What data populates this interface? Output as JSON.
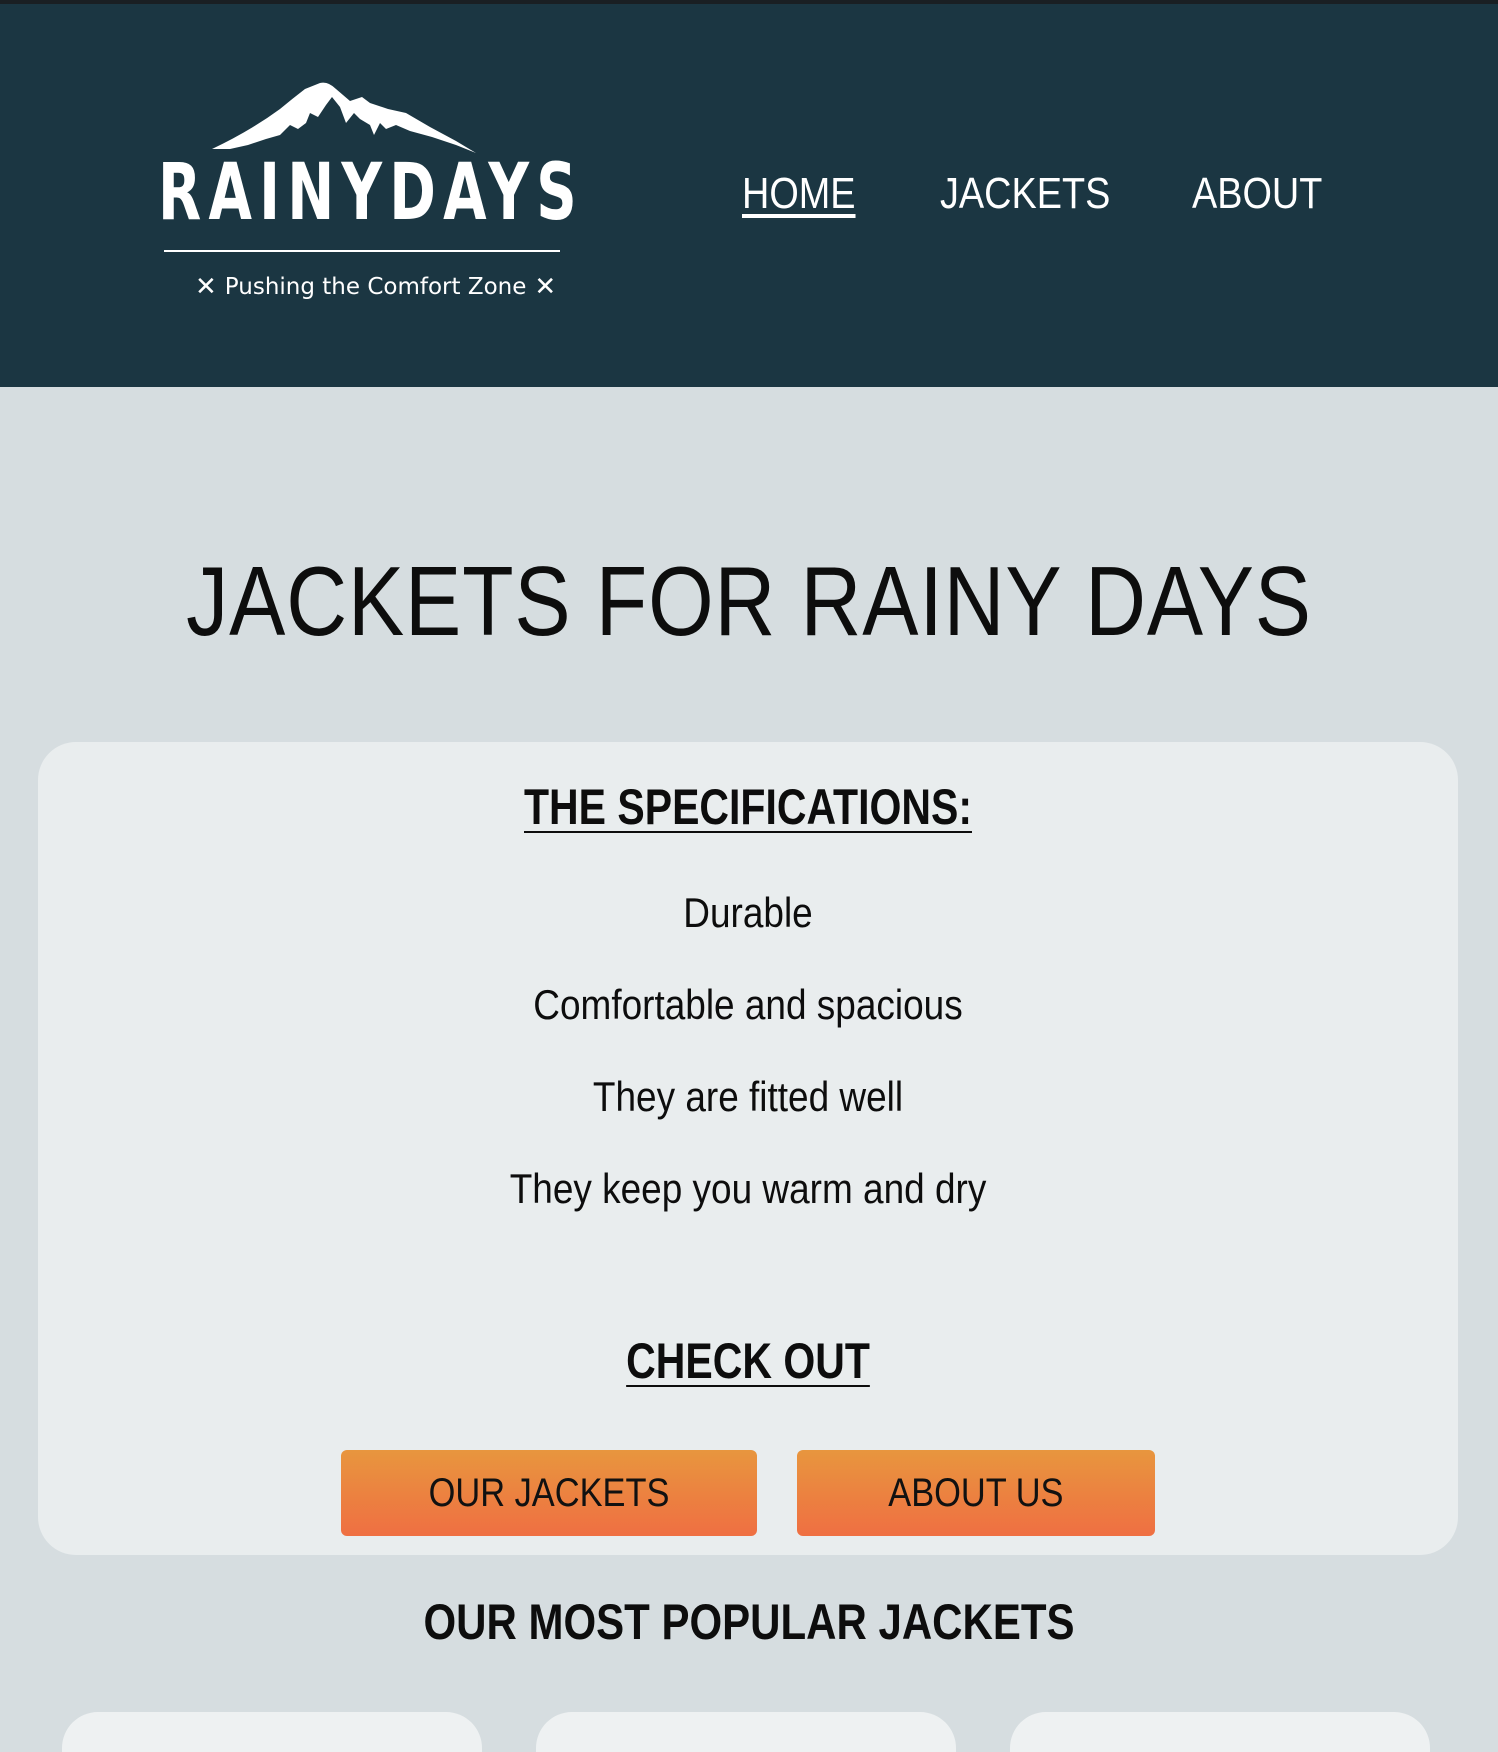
{
  "header": {
    "logo_name": "RAINYDAYS",
    "logo_tagline": "Pushing the Comfort Zone",
    "logo_mark_icon": "mountain-icon",
    "background_color": "#1b3642"
  },
  "nav": {
    "items": [
      {
        "label": "HOME",
        "active": true
      },
      {
        "label": "JACKETS",
        "active": false
      },
      {
        "label": "ABOUT",
        "active": false
      }
    ]
  },
  "main": {
    "title": "JACKETS FOR RAINY DAYS",
    "specs": {
      "heading": "THE SPECIFICATIONS:",
      "items": [
        "Durable",
        "Comfortable and spacious",
        "They are fitted well",
        "They keep you warm and dry"
      ]
    },
    "checkout": {
      "heading": "CHECK OUT",
      "buttons": [
        {
          "label": "OUR JACKETS"
        },
        {
          "label": "ABOUT US"
        }
      ]
    },
    "popular_heading": "OUR MOST POPULAR JACKETS"
  },
  "colors": {
    "page_bg": "#d6dde0",
    "card_bg": "#e9edee",
    "button_gradient_top": "#e8963e",
    "button_gradient_bottom": "#ef6f42"
  }
}
